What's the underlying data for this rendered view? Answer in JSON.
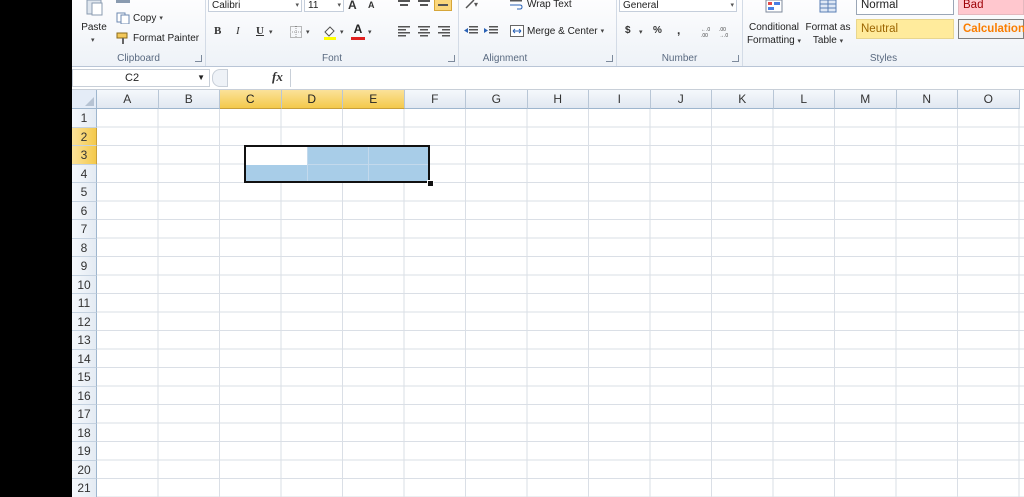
{
  "ribbon": {
    "clipboard": {
      "paste_label": "Paste",
      "copy_label": "Copy",
      "format_painter_label": "Format Painter",
      "group_label": "Clipboard"
    },
    "font": {
      "font_name": "Calibri",
      "font_size": "11",
      "bold": "B",
      "italic": "I",
      "underline": "U",
      "grow": "A",
      "shrink": "A",
      "group_label": "Font"
    },
    "alignment": {
      "wrap_text_label": "Wrap Text",
      "merge_center_label": "Merge & Center",
      "group_label": "Alignment"
    },
    "number": {
      "format": "General",
      "currency": "$",
      "percent": "%",
      "comma": ",",
      "group_label": "Number"
    },
    "styles": {
      "conditional_line1": "Conditional",
      "conditional_line2": "Formatting",
      "format_table_line1": "Format as",
      "format_table_line2": "Table",
      "normal": "Normal",
      "bad": "Bad",
      "neutral": "Neutral",
      "calculation": "Calculation",
      "group_label": "Styles"
    }
  },
  "formula_bar": {
    "name_box": "C2",
    "fx": "fx",
    "formula": ""
  },
  "sheet": {
    "columns": [
      "A",
      "B",
      "C",
      "D",
      "E",
      "F",
      "G",
      "H",
      "I",
      "J",
      "K",
      "L",
      "M",
      "N",
      "O"
    ],
    "rows": [
      "1",
      "2",
      "3",
      "4",
      "5",
      "6",
      "7",
      "8",
      "9",
      "10",
      "11",
      "12",
      "13",
      "14",
      "15",
      "16",
      "17",
      "18",
      "19",
      "20",
      "21"
    ],
    "selected_columns": [
      "C",
      "D",
      "E"
    ],
    "selected_rows": [
      "2",
      "3"
    ],
    "active_cell": "C2",
    "selection_range": "C2:E3"
  },
  "colors": {
    "selection_fill": "#a8cde8",
    "header_highlight": "#f4c94b",
    "neutral_bg": "#ffeb9c",
    "bad_bg": "#ffc7ce",
    "calculation_text": "#fa7d00"
  }
}
